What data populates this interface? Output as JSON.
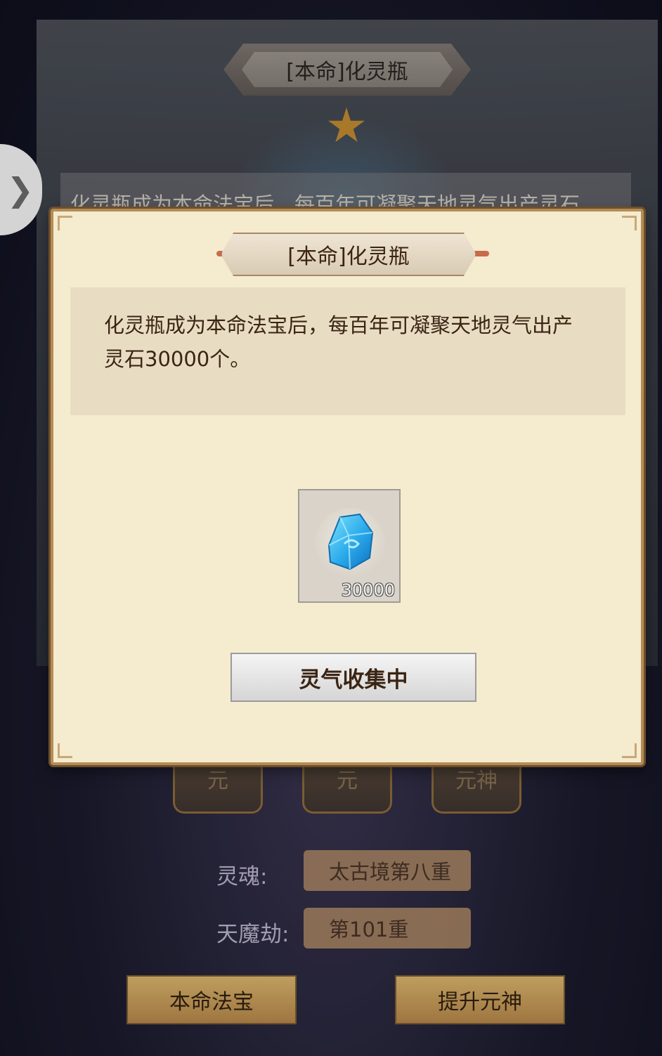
{
  "background": {
    "title": "[本命]化灵瓶",
    "description_preview": "化灵瓶成为本命法宝后，每百年可凝聚天地灵气出产灵石",
    "slots": [
      {
        "label": "元"
      },
      {
        "label": "元"
      },
      {
        "label": "元神"
      }
    ],
    "stats": [
      {
        "label": "灵魂:",
        "value": "太古境第八重"
      },
      {
        "label": "天魔劫:",
        "value": "第101重"
      }
    ],
    "buttons": {
      "left": "本命法宝",
      "right": "提升元神"
    },
    "side_tab_icon": "chevron-right-icon"
  },
  "modal": {
    "title": "[本命]化灵瓶",
    "description": "化灵瓶成为本命法宝后，每百年可凝聚天地灵气出产灵石30000个。",
    "reward": {
      "icon": "spirit-stone-icon",
      "count": "30000"
    },
    "action_button": "灵气收集中"
  }
}
